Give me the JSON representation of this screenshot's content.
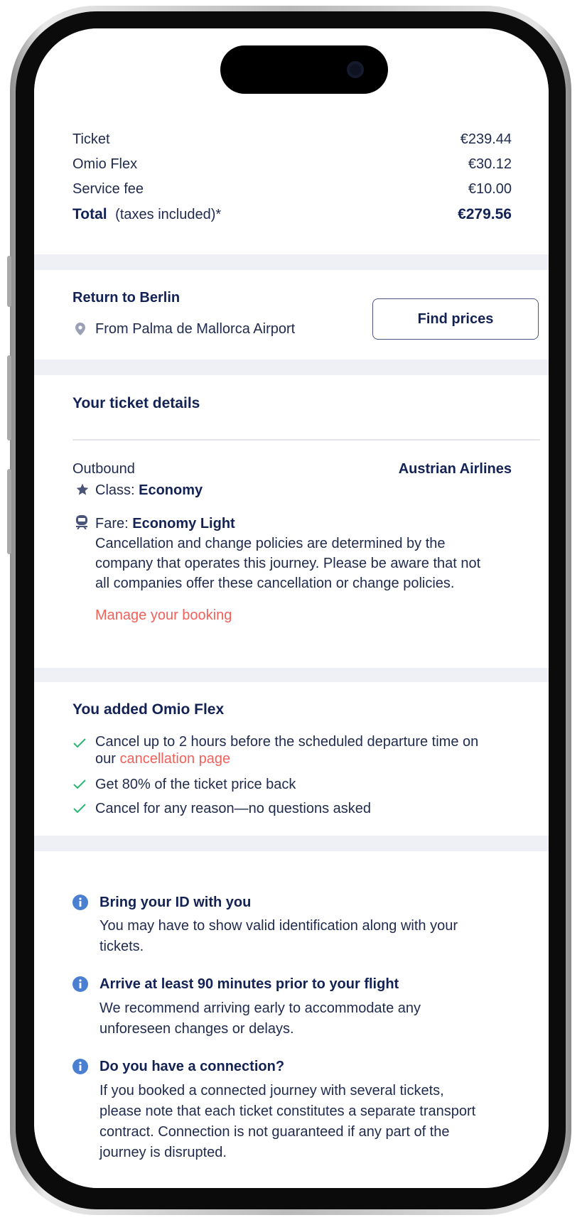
{
  "price": {
    "rows": [
      {
        "label": "Ticket",
        "value": "€239.44"
      },
      {
        "label": "Omio Flex",
        "value": "€30.12"
      },
      {
        "label": "Service fee",
        "value": "€10.00"
      }
    ],
    "total_label": "Total",
    "total_note": "(taxes included)*",
    "total_value": "€279.56"
  },
  "return": {
    "title": "Return to Berlin",
    "from": "From Palma de Mallorca Airport",
    "button": "Find prices",
    "icon": "location-pin-icon"
  },
  "details": {
    "title": "Your ticket details",
    "direction": "Outbound",
    "carrier": "Austrian Airlines",
    "class_label": "Class: ",
    "class_value": "Economy",
    "fare_label": "Fare: ",
    "fare_value": "Economy Light",
    "policy_lines": [
      "Cancellation and change policies are determined by the",
      "company that operates this journey. Please be aware that not",
      "all companies offer these cancellation or change policies."
    ],
    "manage_link": "Manage your booking"
  },
  "flex": {
    "title": "You added Omio Flex",
    "items": [
      {
        "text": "Cancel up to 2 hours before the scheduled departure time on",
        "text2": "our ",
        "link": "cancellation page"
      },
      {
        "text": "Get 80% of the ticket price back"
      },
      {
        "text": "Cancel for any reason—no questions asked"
      }
    ]
  },
  "info": [
    {
      "title": "Bring your ID with you",
      "lines": [
        "You may have to show valid identification along with your",
        "tickets."
      ]
    },
    {
      "title": "Arrive at least 90 minutes prior to your flight",
      "lines": [
        "We recommend arriving early to accommodate any",
        "unforeseen changes or delays."
      ]
    },
    {
      "title": "Do you have a connection?",
      "lines": [
        "If you booked a connected journey with several tickets,",
        "please note that each ticket constitutes a separate transport",
        "contract. Connection is not guaranteed if any part of the",
        "journey is disrupted."
      ]
    }
  ],
  "colors": {
    "navy": "#132255",
    "link": "#f2605a",
    "check": "#2bb673",
    "info": "#4a7fd1",
    "bg": "#eef0f5"
  }
}
